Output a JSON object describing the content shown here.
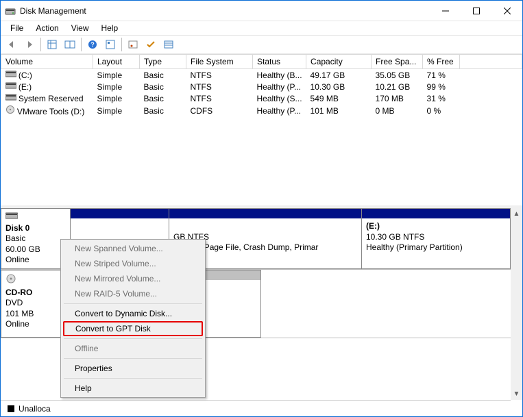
{
  "window": {
    "title": "Disk Management"
  },
  "menubar": [
    "File",
    "Action",
    "View",
    "Help"
  ],
  "columns": [
    "Volume",
    "Layout",
    "Type",
    "File System",
    "Status",
    "Capacity",
    "Free Spa...",
    "% Free"
  ],
  "volumes": [
    {
      "icon": "disk",
      "name": "(C:)",
      "layout": "Simple",
      "type": "Basic",
      "fs": "NTFS",
      "status": "Healthy (B...",
      "capacity": "49.17 GB",
      "free": "35.05 GB",
      "pct": "71 %"
    },
    {
      "icon": "disk",
      "name": "(E:)",
      "layout": "Simple",
      "type": "Basic",
      "fs": "NTFS",
      "status": "Healthy (P...",
      "capacity": "10.30 GB",
      "free": "10.21 GB",
      "pct": "99 %"
    },
    {
      "icon": "disk",
      "name": "System Reserved",
      "layout": "Simple",
      "type": "Basic",
      "fs": "NTFS",
      "status": "Healthy (S...",
      "capacity": "549 MB",
      "free": "170 MB",
      "pct": "31 %"
    },
    {
      "icon": "cd",
      "name": "VMware Tools (D:)",
      "layout": "Simple",
      "type": "Basic",
      "fs": "CDFS",
      "status": "Healthy (P...",
      "capacity": "101 MB",
      "free": "0 MB",
      "pct": "0 %"
    }
  ],
  "disks": {
    "disk0": {
      "name": "Disk 0",
      "type": "Basic",
      "size": "60.00 GB",
      "status": "Online"
    },
    "cdrom": {
      "name": "CD-RO",
      "type": "DVD",
      "size": "101 MB",
      "status": "Online"
    }
  },
  "partitions": {
    "p1": {
      "name": "",
      "size": "GB NTFS",
      "status": "y (Boot, Page File, Crash Dump, Primar"
    },
    "p2": {
      "name": "(E:)",
      "size": "10.30 GB NTFS",
      "status": "Healthy (Primary Partition)"
    }
  },
  "legend": {
    "unalloc": "Unalloca"
  },
  "ctx": {
    "spanned": "New Spanned Volume...",
    "striped": "New Striped Volume...",
    "mirrored": "New Mirrored Volume...",
    "raid5": "New RAID-5 Volume...",
    "dynamic": "Convert to Dynamic Disk...",
    "gpt": "Convert to GPT Disk",
    "offline": "Offline",
    "props": "Properties",
    "help": "Help"
  }
}
